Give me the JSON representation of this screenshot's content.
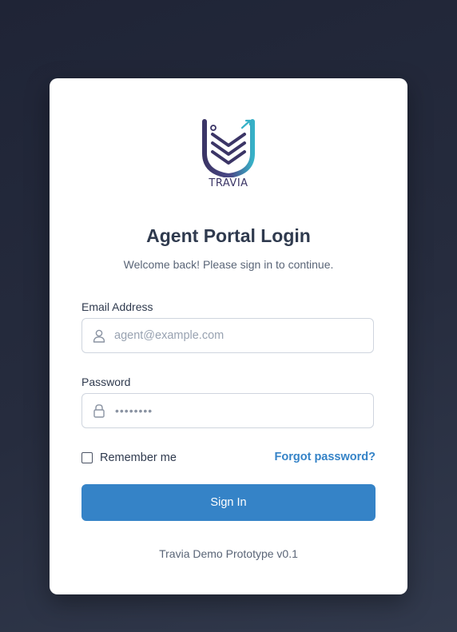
{
  "brand": {
    "logo_text": "TRAVIA",
    "colors": {
      "primary": "#3583c7",
      "logo_dark": "#3b3566",
      "logo_teal": "#37b1c7"
    }
  },
  "login": {
    "title": "Agent Portal Login",
    "subtitle": "Welcome back! Please sign in to continue.",
    "email": {
      "label": "Email Address",
      "placeholder": "agent@example.com",
      "icon": "user-icon"
    },
    "password": {
      "label": "Password",
      "masked_value": "••••••••",
      "icon": "lock-icon"
    },
    "remember_label": "Remember me",
    "remember_checked": false,
    "forgot_label": "Forgot password?",
    "submit_label": "Sign In"
  },
  "footer": {
    "text": "Travia Demo Prototype v0.1"
  }
}
